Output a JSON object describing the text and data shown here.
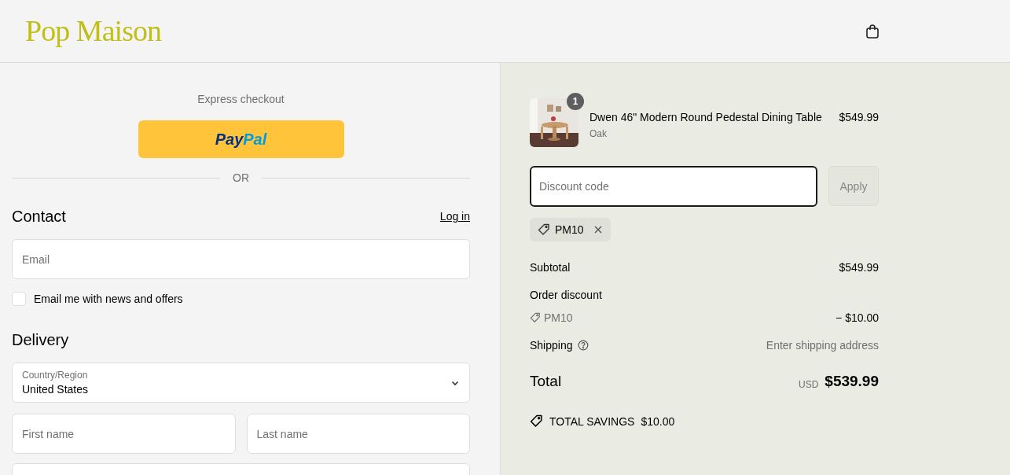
{
  "header": {
    "logo": "Pop Maison"
  },
  "express": {
    "title": "Express checkout",
    "paypal_parts": [
      "Pay",
      "Pal"
    ],
    "divider": "OR"
  },
  "contact": {
    "heading": "Contact",
    "login": "Log in",
    "email_placeholder": "Email",
    "newsletter": {
      "label": "Email me with news and offers",
      "checked": false
    }
  },
  "delivery": {
    "heading": "Delivery",
    "country_label": "Country/Region",
    "country_value": "United States",
    "first_name_placeholder": "First name",
    "last_name_placeholder": "Last name"
  },
  "summary": {
    "item": {
      "quantity": "1",
      "name": "Dwen 46\" Modern Round Pedestal Dining Table",
      "variant": "Oak",
      "price": "$549.99"
    },
    "discount": {
      "placeholder": "Discount code",
      "apply": "Apply",
      "applied_code": "PM10"
    },
    "subtotal": {
      "label": "Subtotal",
      "value": "$549.99"
    },
    "order_discount": {
      "label": "Order discount",
      "code": "PM10",
      "value": "− $10.00"
    },
    "shipping": {
      "label": "Shipping",
      "value": "Enter shipping address"
    },
    "total": {
      "label": "Total",
      "currency": "USD",
      "value": "$539.99"
    },
    "savings": {
      "label": "TOTAL SAVINGS",
      "value": "$10.00"
    }
  }
}
